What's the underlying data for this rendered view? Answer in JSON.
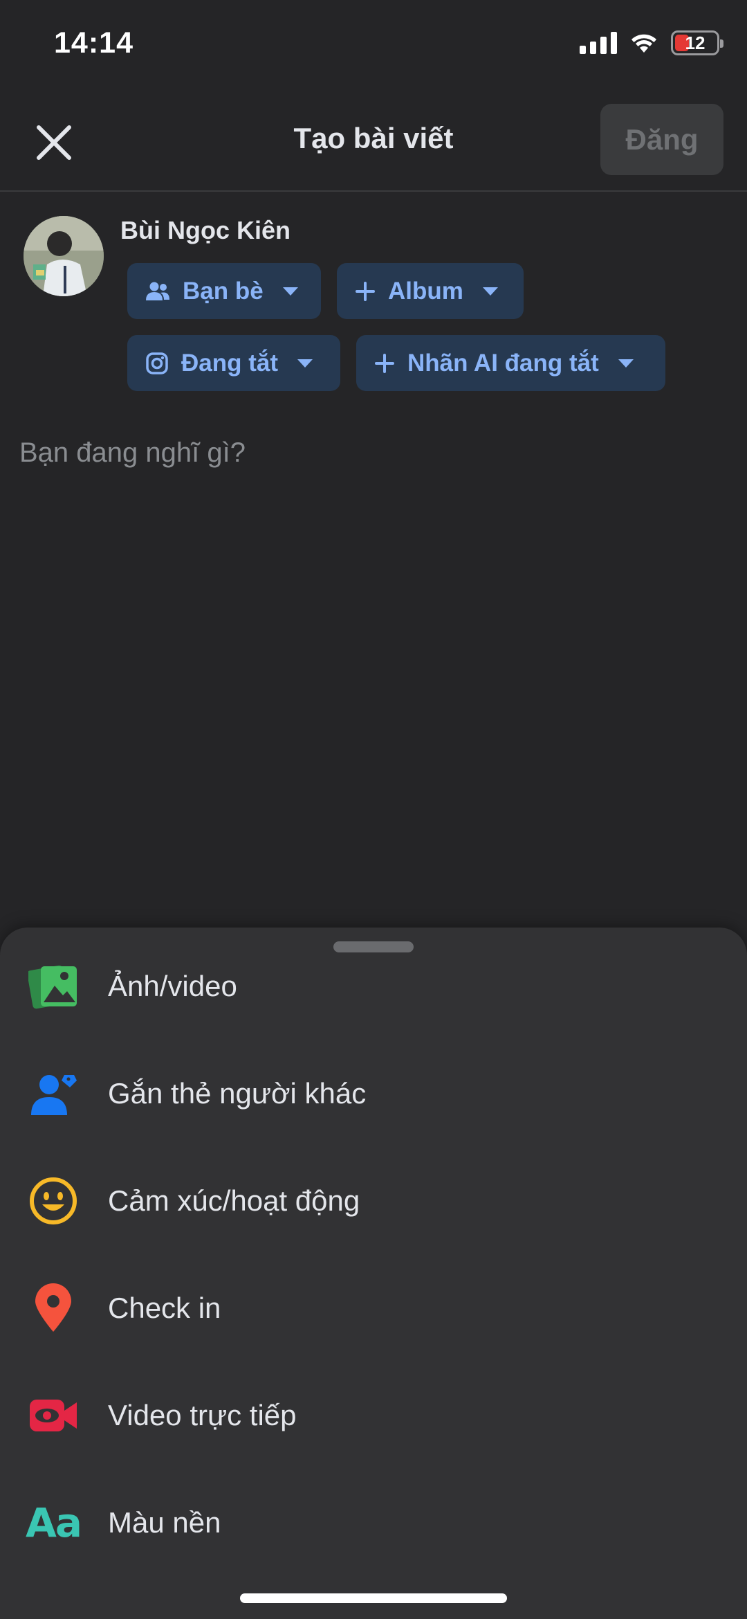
{
  "status_bar": {
    "time": "14:14",
    "battery": "12"
  },
  "header": {
    "title": "Tạo bài viết",
    "post_label": "Đăng"
  },
  "user": {
    "name": "Bùi Ngọc Kiên"
  },
  "chips": {
    "friends": "Bạn bè",
    "album": "Album",
    "instagram": "Đang tắt",
    "ai_label": "Nhãn AI đang tắt"
  },
  "composer": {
    "placeholder": "Bạn đang nghĩ gì?"
  },
  "sheet": {
    "items": [
      {
        "label": "Ảnh/video",
        "icon": "photo-video-icon",
        "color": "#45bd62"
      },
      {
        "label": "Gắn thẻ người khác",
        "icon": "tag-people-icon",
        "color": "#1877f2"
      },
      {
        "label": "Cảm xúc/hoạt động",
        "icon": "feeling-icon",
        "color": "#f7b928"
      },
      {
        "label": "Check in",
        "icon": "location-pin-icon",
        "color": "#f5533d"
      },
      {
        "label": "Video trực tiếp",
        "icon": "live-video-icon",
        "color": "#e42645"
      },
      {
        "label": "Màu nền",
        "icon": "background-color-icon",
        "color": "#3ac6b3",
        "icon_text": "Aa"
      }
    ]
  },
  "colors": {
    "background": "#252527",
    "sheet": "#323234",
    "chip_bg": "#263951",
    "chip_text": "#8ab4f8",
    "post_button_disabled": "#3a3b3d"
  }
}
